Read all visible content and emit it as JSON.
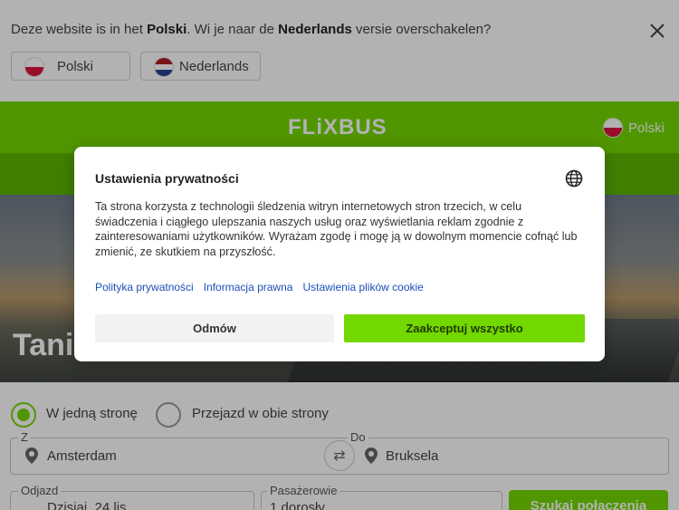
{
  "language_banner": {
    "message_prefix": "Deze website is in het ",
    "current_language": "Polski",
    "message_middle": ". Wi je naar de ",
    "target_language": "Nederlands",
    "message_suffix": " versie overschakelen?",
    "buttons": [
      {
        "label": "Polski",
        "flag": "pl"
      },
      {
        "label": "Nederlands",
        "flag": "nl"
      }
    ]
  },
  "header": {
    "logo": "FLiXBUS",
    "language": "Polski",
    "brand_color": "#73d700"
  },
  "hero": {
    "title": "Tani "
  },
  "search": {
    "trip_types": [
      "W jedną stronę",
      "Przejazd w obie strony"
    ],
    "selected_trip_type": "W jedną stronę",
    "from": {
      "label": "Z",
      "value": "Amsterdam"
    },
    "to": {
      "label": "Do",
      "value": "Bruksela"
    },
    "departure": {
      "label": "Odjazd",
      "value": "Dzisiaj, 24 lis"
    },
    "passengers": {
      "label": "Pasażerowie",
      "value": "1 dorosły"
    },
    "submit_label": "Szukaj połączenia"
  },
  "privacy_modal": {
    "title": "Ustawienia prywatności",
    "body": "Ta strona korzysta z technologii śledzenia witryn internetowych stron trzecich, w celu świadczenia i ciągłego ulepszania naszych usług oraz wyświetlania reklam zgodnie z zainteresowaniami użytkowników. Wyrażam zgodę i mogę ją w dowolnym momencie cofnąć lub zmienić, ze skutkiem na przyszłość.",
    "links": [
      "Polityka prywatności",
      "Informacja prawna",
      "Ustawienia plików cookie"
    ],
    "decline_label": "Odmów",
    "accept_label": "Zaakceptuj wszystko",
    "icon": "globe-icon"
  }
}
